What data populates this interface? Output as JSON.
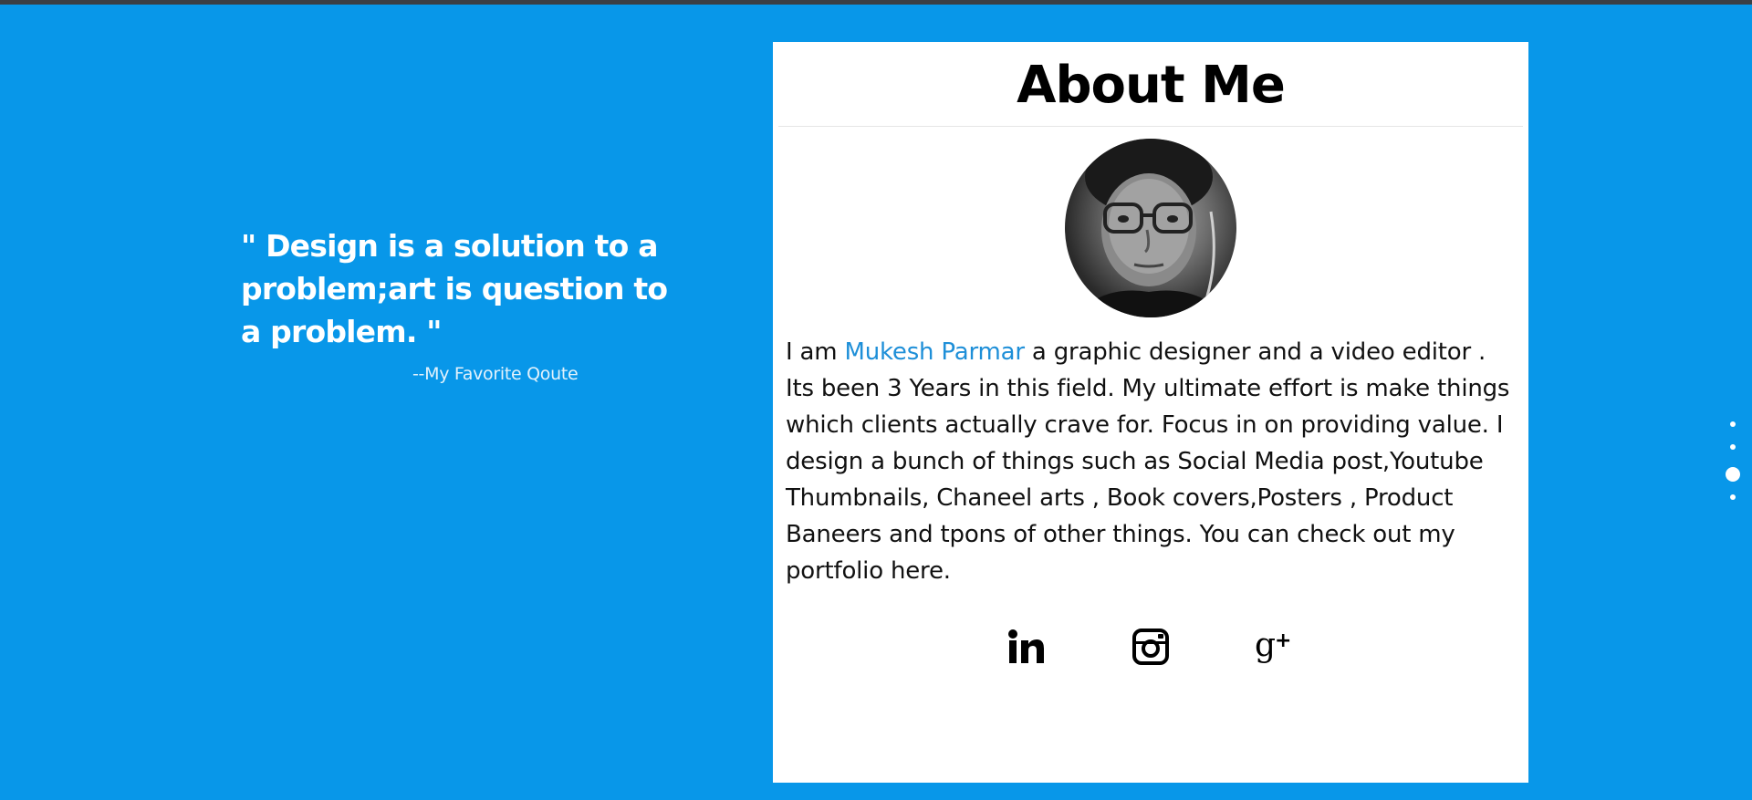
{
  "quote": {
    "text": "\" Design is a solution to a problem;art is question to a problem. \"",
    "author": "--My Favorite Qoute"
  },
  "about": {
    "title": "About Me",
    "bio_prefix": "I am ",
    "name": "Mukesh Parmar",
    "bio_rest": " a graphic designer and a video editor . Its been 3 Years in this field. My ultimate effort is make things which clients actually crave for. Focus in on providing value. I design a bunch of things such as Social Media post,Youtube Thumbnails, Chaneel arts , Book covers,Posters , Product Baneers and tpons of other things. You can check out my portfolio here."
  },
  "socials": [
    {
      "icon": "linkedin-icon"
    },
    {
      "icon": "instagram-icon"
    },
    {
      "icon": "google-plus-icon"
    }
  ],
  "page_dots": {
    "count": 4,
    "active_index": 2
  },
  "colors": {
    "background": "#0897e9",
    "card": "#ffffff",
    "accent_name": "#1e8fd8",
    "top_bar": "#3b3f45"
  }
}
